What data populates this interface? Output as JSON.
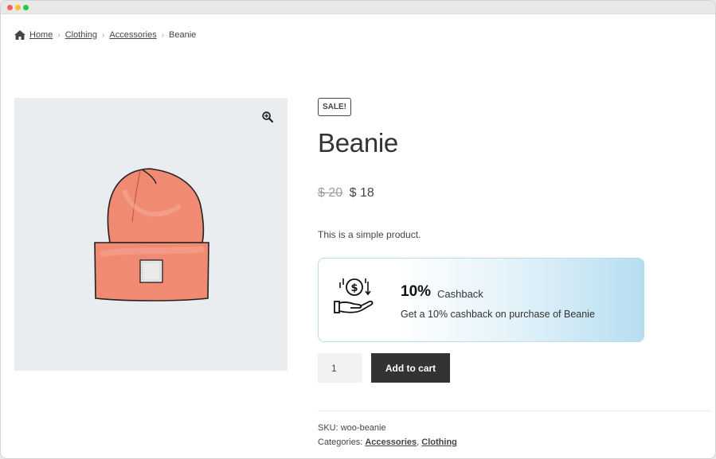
{
  "breadcrumb": {
    "items": [
      "Home",
      "Clothing",
      "Accessories"
    ],
    "current": "Beanie"
  },
  "product": {
    "sale_badge": "SALE!",
    "title": "Beanie",
    "old_price": "$ 20",
    "price": "$ 18",
    "description": "This is a simple product.",
    "image_icon": "beanie-hat-illustration"
  },
  "cashback": {
    "percent": "10%",
    "label": "Cashback",
    "description": "Get a 10% cashback on purchase of Beanie",
    "icon": "hand-coin-icon"
  },
  "cart": {
    "quantity": "1",
    "button_label": "Add to cart"
  },
  "meta": {
    "sku_text": "SKU: woo-beanie",
    "categories_label": "Categories:",
    "categories": [
      "Accessories",
      "Clothing"
    ],
    "separator": ","
  },
  "colors": {
    "button_bg": "#333333",
    "cashback_gradient_end": "#b7def1",
    "beanie": "#f08a73"
  }
}
